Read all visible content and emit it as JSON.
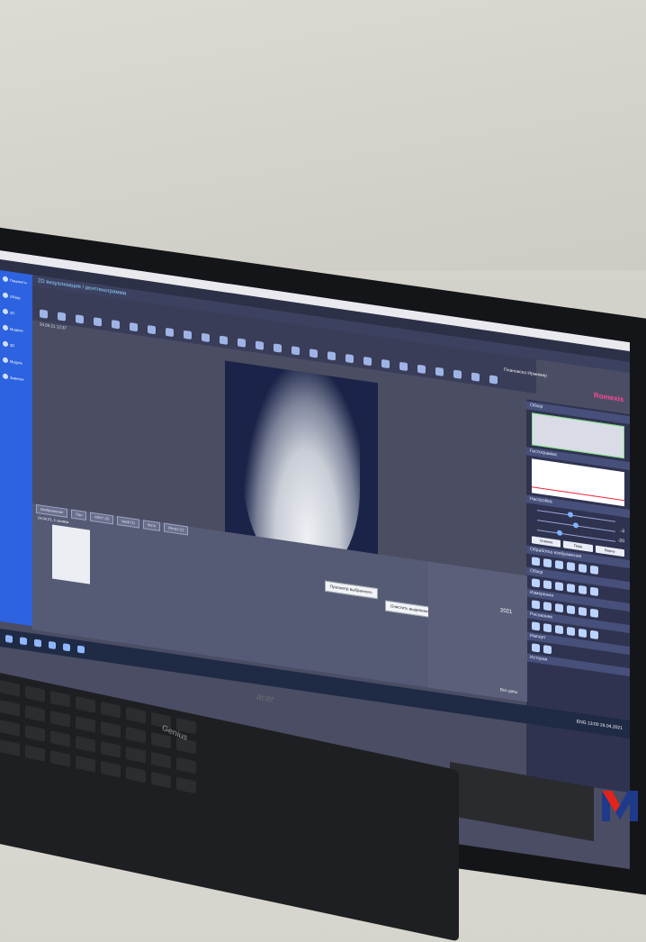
{
  "screen": {
    "breadcrumb": "2D визуализация / рентгенограмма",
    "date_time": "24.04.21 12:37",
    "user_name": "Плановска Ирмимир",
    "brand": "Romexis",
    "sidebar": [
      {
        "label": "Пациенты"
      },
      {
        "label": "Обзор"
      },
      {
        "label": "2D"
      },
      {
        "label": "Модели"
      },
      {
        "label": "3D"
      },
      {
        "label": "Модуль"
      },
      {
        "label": "Заметки"
      }
    ],
    "panel": {
      "overview": "Обзор",
      "histogram": "Гистограмма",
      "adjust": "Настройка",
      "cancel": "Отмена",
      "apply": "Пере",
      "reset": "Верну",
      "processing": "Обработка изображения",
      "view": "Обзор",
      "measurements": "Измерения",
      "drawing": "Рисование",
      "tools": "Импорт",
      "history": "История",
      "slider_values": [
        "-3",
        "-20"
      ]
    },
    "tabs": [
      "Изображения",
      "Пан",
      "КЛКТ 2D",
      "Цеф (1)",
      "Фото",
      "Интра (1)"
    ],
    "thumb_caption": "24.04.21, 1 снимок",
    "actions": [
      "Просмотр выбранного",
      "Очистить выделения"
    ],
    "year": "2021",
    "all_dates": "Все даты",
    "clock": "13:00",
    "lang": "ENG",
    "date": "24.04.2021"
  },
  "keyboard_brand": "Genius",
  "monitor_brand": "acer",
  "colors": {
    "sidebar": "#2d62e0",
    "brand_accent": "#ff4a9a",
    "logo_red": "#e2231a",
    "logo_blue": "#1f3a8a"
  }
}
